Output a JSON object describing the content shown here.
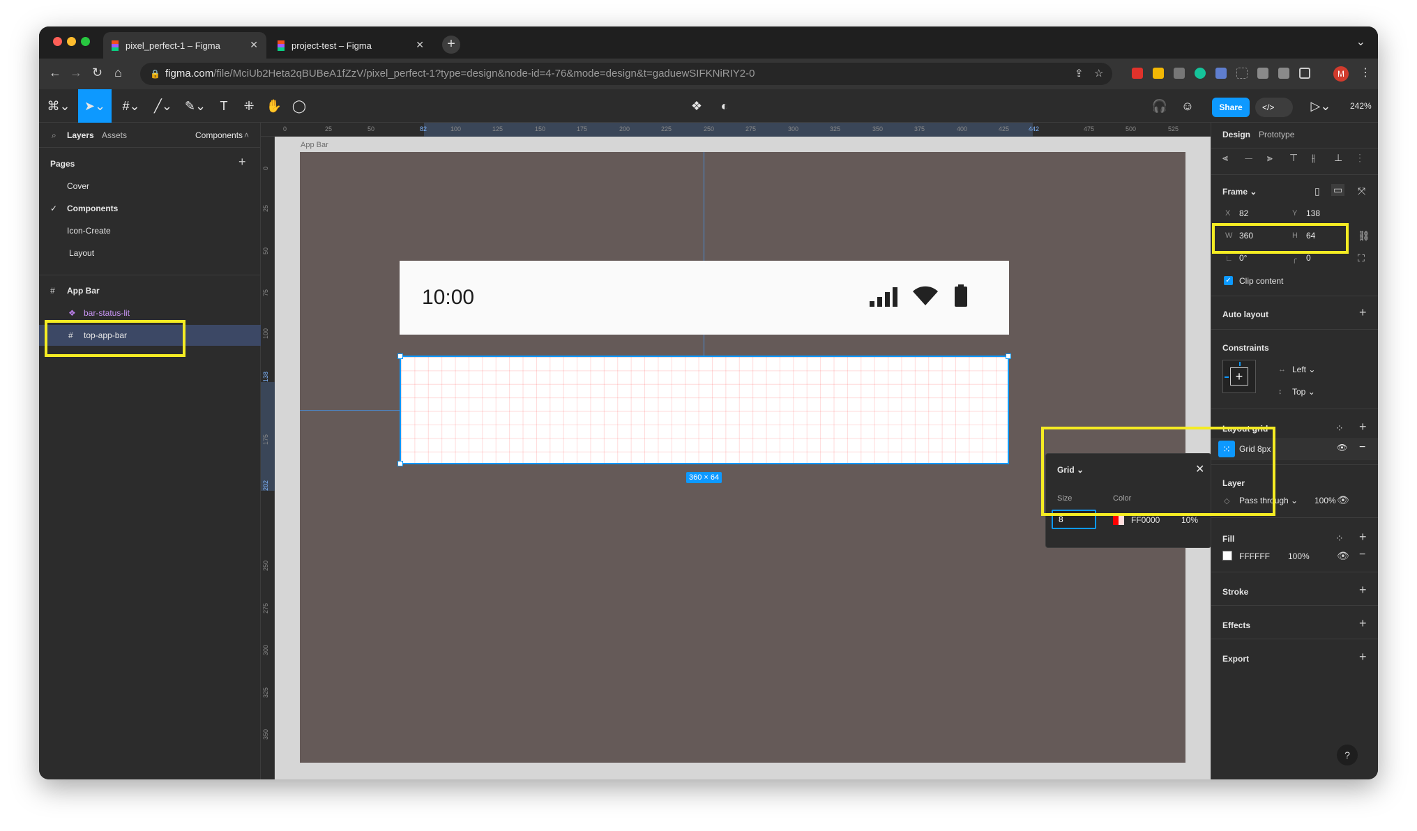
{
  "browser": {
    "tabs": [
      {
        "title": "pixel_perfect-1 – Figma",
        "active": true
      },
      {
        "title": "project-test – Figma",
        "active": false
      }
    ],
    "url_host": "figma.com",
    "url_path": "/file/MciUb2Heta2qBUBeA1fZzV/pixel_perfect-1?type=design&node-id=4-76&mode=design&t=gaduewSIFKNiRIY2-0",
    "profile_initial": "M"
  },
  "toolbar": {
    "share_label": "Share",
    "dev_label": "</>",
    "zoom": "242%"
  },
  "left_panel": {
    "tab_layers": "Layers",
    "tab_assets": "Assets",
    "current_page": "Components",
    "pages_title": "Pages",
    "pages": [
      "Cover",
      "Components",
      "Icon-Create",
      "Layout"
    ],
    "layers": {
      "frame": "App Bar",
      "child1": "bar-status-lit",
      "child2": "top-app-bar"
    }
  },
  "canvas": {
    "frame_label": "App Bar",
    "status_time": "10:00",
    "selection_size": "360 × 64",
    "ruler_top": [
      "0",
      "25",
      "50",
      "82",
      "100",
      "125",
      "150",
      "175",
      "200",
      "225",
      "250",
      "275",
      "300",
      "325",
      "350",
      "375",
      "400",
      "425",
      "442",
      "475",
      "500",
      "525"
    ],
    "ruler_left": [
      "0",
      "25",
      "50",
      "75",
      "100",
      "138",
      "175",
      "202",
      "250",
      "275",
      "300",
      "325",
      "350"
    ]
  },
  "grid_popover": {
    "title": "Grid",
    "size_label": "Size",
    "color_label": "Color",
    "size_value": "8",
    "color_hex": "FF0000",
    "opacity": "10%"
  },
  "right_panel": {
    "tab_design": "Design",
    "tab_prototype": "Prototype",
    "frame_title": "Frame",
    "x_label": "X",
    "x": "82",
    "y_label": "Y",
    "y": "138",
    "w_label": "W",
    "w": "360",
    "h_label": "H",
    "h": "64",
    "rotation": "0°",
    "radius": "0",
    "clip_content": "Clip content",
    "auto_layout": "Auto layout",
    "constraints": "Constraints",
    "constraint_h": "Left",
    "constraint_v": "Top",
    "layout_grid": "Layout grid",
    "grid_item": "Grid 8px",
    "layer_title": "Layer",
    "blend": "Pass through",
    "layer_opacity": "100%",
    "fill_title": "Fill",
    "fill_hex": "FFFFFF",
    "fill_opacity": "100%",
    "stroke": "Stroke",
    "effects": "Effects",
    "export": "Export",
    "help": "?"
  },
  "colors": {
    "accent": "#0d99ff",
    "highlight": "#f5ec23",
    "frame_bg": "#655a58",
    "grid_color": "#ff0000"
  }
}
